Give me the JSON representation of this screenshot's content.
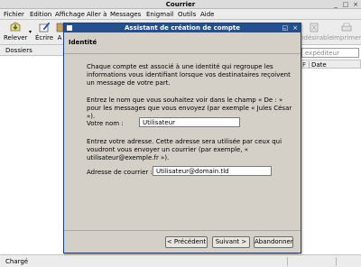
{
  "window": {
    "title": "Courrier"
  },
  "menu": [
    "Fichier",
    "Edition",
    "Affichage",
    "Aller à",
    "Messages",
    "Enigmail",
    "Outils",
    "Aide"
  ],
  "toolbar": {
    "relever": "Relever",
    "ecrire": "Écrire",
    "adresses": "A",
    "indesirable": "Indésirable",
    "imprimer": "Imprimer"
  },
  "folders": {
    "header": "Dossiers"
  },
  "messages": {
    "search_placeholder": "expéditeur",
    "col_flag": "F",
    "col_date": "Date"
  },
  "status": {
    "text": "Chargé"
  },
  "dialog": {
    "title": "Assistant de création de compte",
    "heading": "Identité",
    "intro": "Chaque compte est associé à une identité qui regroupe les informations vous identifiant lorsque vos destinataires reçoivent un message de votre part.",
    "name_help": "Entrez le nom que vous souhaitez voir dans le champ « De : » pour les messages que vous envoyez (par exemple « Jules César »).",
    "name_label": "Votre nom  :",
    "name_value": "Utilisateur",
    "email_help": "Entrez votre adresse. Cette adresse sera utilisée par ceux qui voudront vous envoyer un courrier (par exemple, « utilisateur@exemple.fr »).",
    "email_label": "Adresse de courrier  :",
    "email_value": "Utilisateur@domain.tld",
    "btn_prev": "< Précédent",
    "btn_next": "Suivant >",
    "btn_cancel": "Abandonner"
  }
}
